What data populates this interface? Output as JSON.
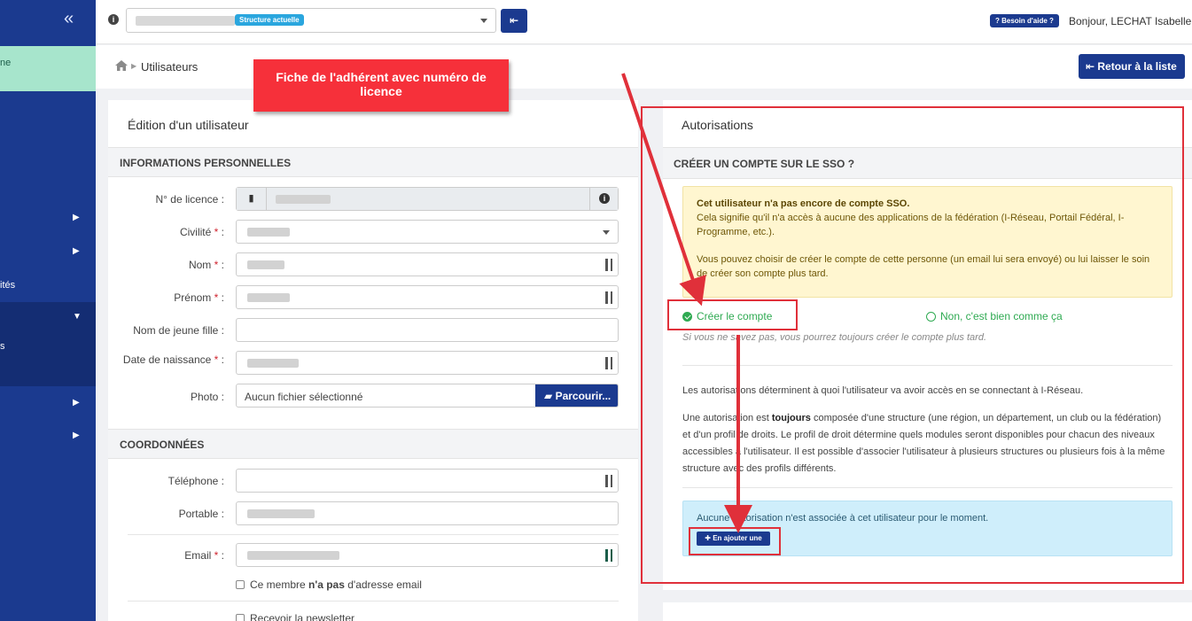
{
  "topbar": {
    "structure_badge": "Structure actuelle",
    "help_label": "Besoin d'aide ?",
    "greeting": "Bonjour, LECHAT Isabelle"
  },
  "sidebar": {
    "active_item_partial": "ne",
    "item_partial_1": "ités",
    "item_partial_2": "s"
  },
  "breadcrumb": {
    "title": "Utilisateurs",
    "back_button": "Retour à la liste"
  },
  "callout": {
    "text": "Fiche de l'adhérent avec numéro de licence"
  },
  "edit_card": {
    "title": "Édition d'un utilisateur",
    "personal_section": "INFORMATIONS PERSONNELLES",
    "fields": {
      "licence": "N° de licence :",
      "civility": "Civilité",
      "last_name": "Nom",
      "first_name": "Prénom",
      "maiden_name": "Nom de jeune fille :",
      "birth_date": "Date de naissance",
      "photo": "Photo :"
    },
    "required_suffix": " :",
    "required_star": "*",
    "photo_no_file": "Aucun fichier sélectionné",
    "browse_button": "Parcourir...",
    "contact_section": "COORDONNÉES",
    "contact_fields": {
      "phone": "Téléphone :",
      "mobile": "Portable :",
      "email": "Email"
    },
    "no_email_pre": "Ce membre ",
    "no_email_bold": "n'a pas",
    "no_email_post": " d'adresse email",
    "newsletter": "Recevoir la newsletter"
  },
  "auth_card": {
    "title": "Autorisations",
    "sso_section": "CRÉER UN COMPTE SUR LE SSO ?",
    "warning_title": "Cet utilisateur n'a pas encore de compte SSO.",
    "warning_line": "Cela signifie qu'il n'a accès à aucune des applications de la fédération (I-Réseau, Portail Fédéral, I-Programme, etc.).",
    "warning_choice": "Vous pouvez choisir de créer le compte de cette personne (un email lui sera envoyé) ou lui laisser le soin de créer son compte plus tard.",
    "radio_create": "Créer le compte",
    "radio_no": "Non, c'est bien comme ça",
    "hint": "Si vous ne savez pas, vous pourrez toujours créer le compte plus tard.",
    "para1": "Les autorisations déterminent à quoi l'utilisateur va avoir accès en se connectant à I-Réseau.",
    "para2_pre": "Une autorisation est ",
    "para2_bold": "toujours",
    "para2_post": " composée d'une structure (une région, un département, un club ou la fédération) et d'un profil de droits. Le profil de droit détermine quels modules seront disponibles pour chacun des niveaux accessibles à l'utilisateur. Il est possible d'associer l'utilisateur à plusieurs structures ou plusieurs fois à la même structure avec des profils différents.",
    "none_text": "Aucune autorisation n'est associée à cet utilisateur pour le moment.",
    "add_button": "En ajouter une"
  },
  "colors": {
    "primary": "#1b3a8f",
    "accent_green": "#2faa52",
    "annotation_red": "#e0303a"
  }
}
